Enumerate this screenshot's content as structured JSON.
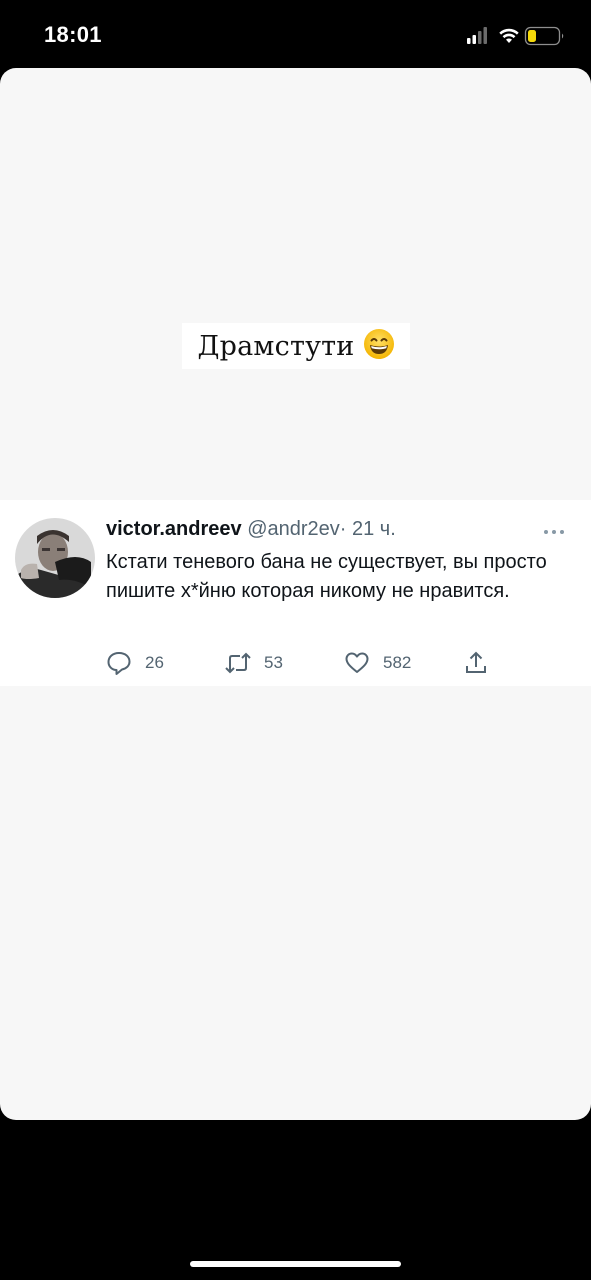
{
  "status_bar": {
    "time": "18:01",
    "icons": [
      "signal-icon",
      "wifi-icon",
      "battery-icon"
    ],
    "battery_color": "#f5d90a"
  },
  "story": {
    "caption": "Драмстути",
    "caption_emoji": "grinning-face-emoji"
  },
  "tweet": {
    "name": "victor.andreev",
    "handle": "@andr2ev",
    "separator": "·",
    "time": "21 ч.",
    "text": "Кстати теневого бана не существует, вы просто пишите х*йню которая никому не нравится.",
    "actions": {
      "replies": "26",
      "retweets": "53",
      "likes": "582"
    }
  },
  "colors": {
    "text_primary": "#0f1419",
    "text_secondary": "#536471",
    "card_background": "#f7f7f7"
  }
}
